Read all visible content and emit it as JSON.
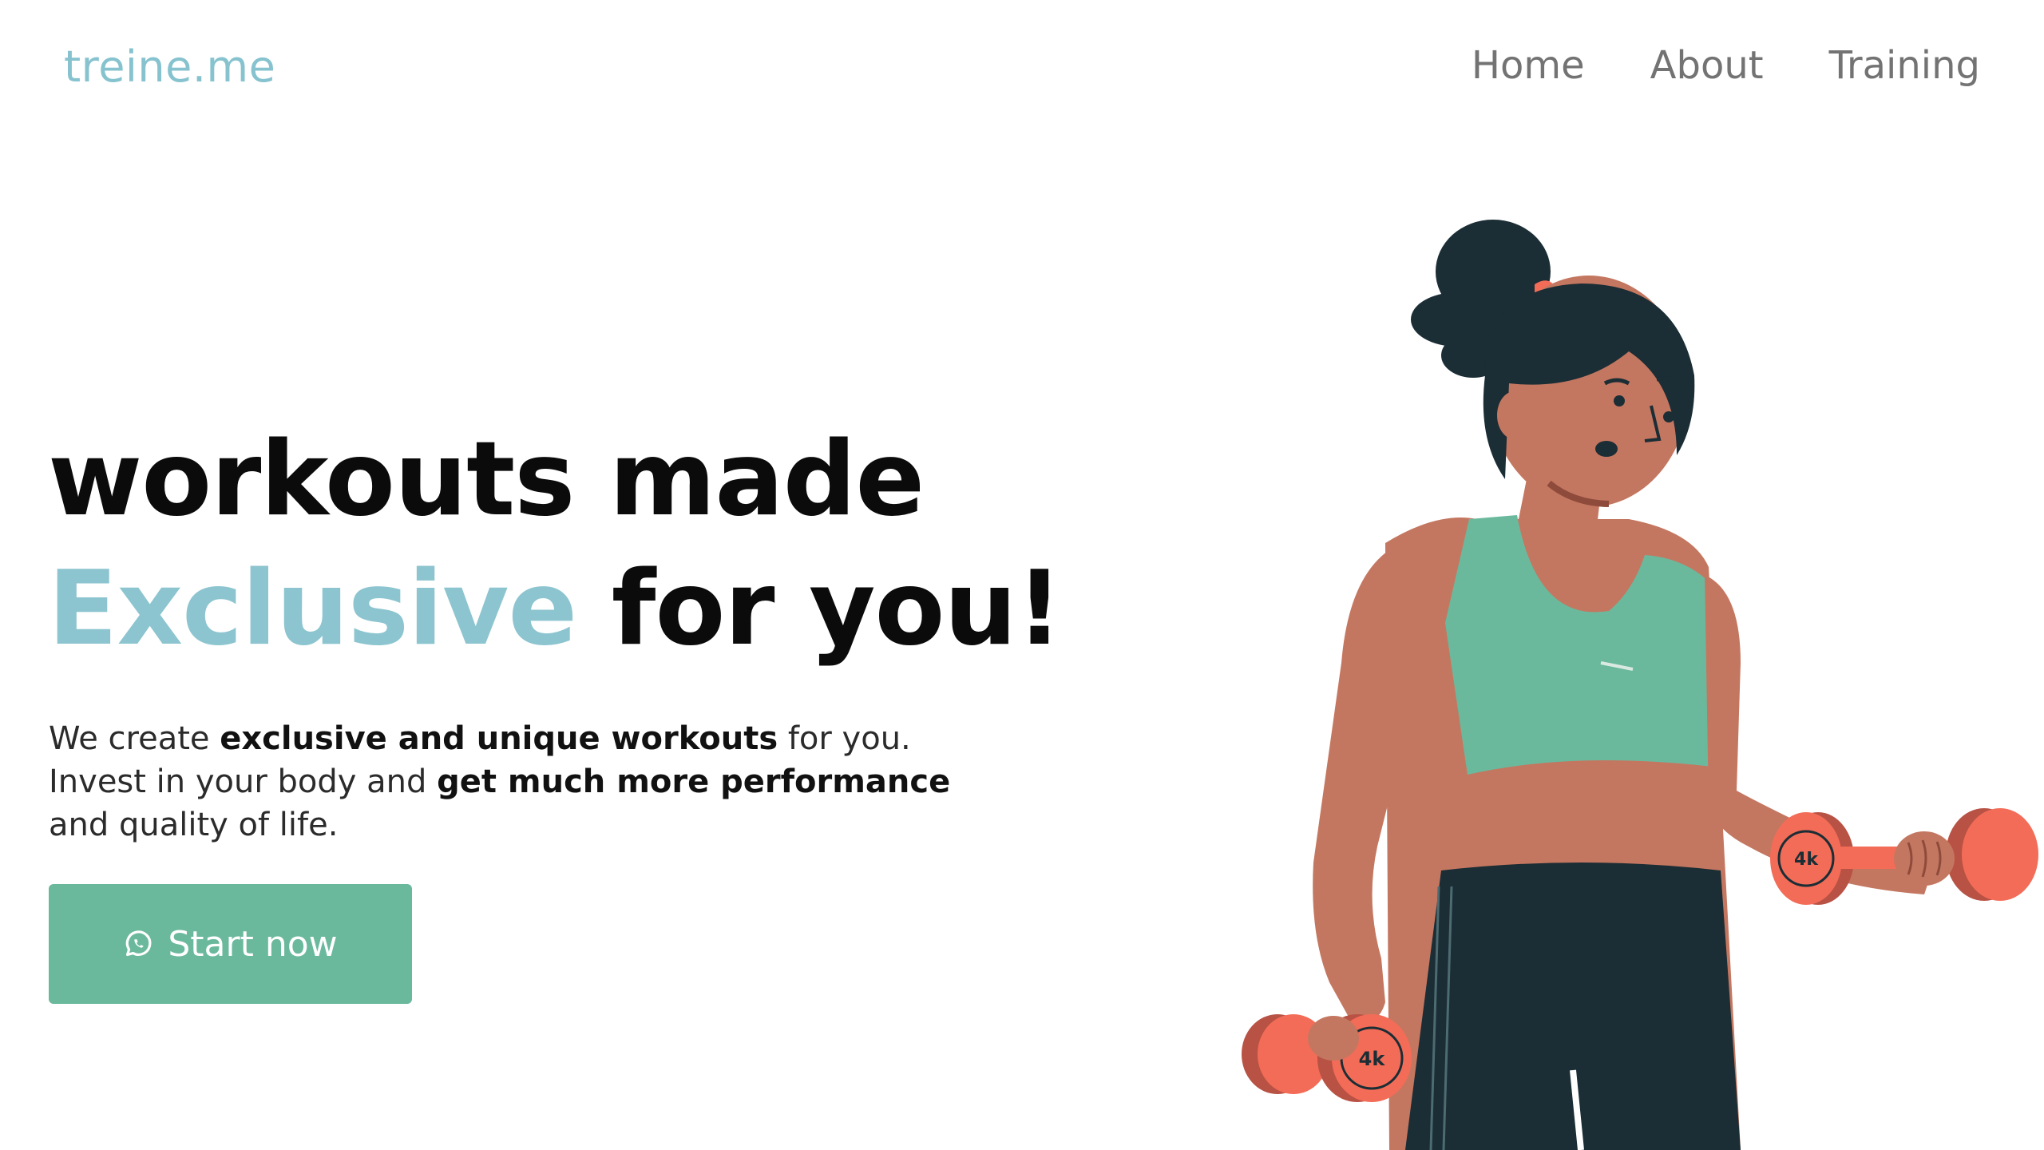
{
  "header": {
    "logo": "treine.me",
    "nav": [
      {
        "label": "Home"
      },
      {
        "label": "About"
      },
      {
        "label": "Training"
      }
    ]
  },
  "hero": {
    "title_line1": "workouts made",
    "title_accent": "Exclusive",
    "title_rest": " for you!",
    "description": {
      "part1": "We create ",
      "bold1": "exclusive and unique workouts",
      "part2": " for you. Invest in your body and ",
      "bold2": "get much more performance",
      "part3": " and quality of life."
    },
    "cta_label": "Start now",
    "cta_icon": "whatsapp-icon"
  },
  "illustration": {
    "dumbbell_label_left": "4k",
    "dumbbell_label_right": "4k"
  },
  "colors": {
    "accent": "#86c3cf",
    "button": "#6bb99d",
    "nav_text": "#737373"
  }
}
